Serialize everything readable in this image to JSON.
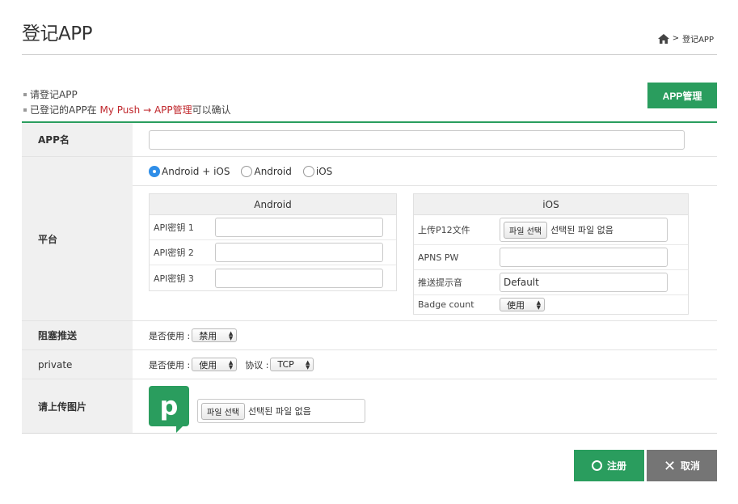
{
  "page": {
    "title": "登记APP"
  },
  "breadcrumb": {
    "separator": ">",
    "current": "登记APP"
  },
  "notes": {
    "line1": "请登记APP",
    "line2_prefix": "已登记的APP在 ",
    "line2_link": "My Push → APP管理",
    "line2_suffix": "可以确认"
  },
  "app_manage_button": "APP管理",
  "form": {
    "app_name": {
      "label": "APP名",
      "value": ""
    },
    "platform": {
      "label": "平台",
      "options": [
        "Android + iOS",
        "Android",
        "iOS"
      ],
      "selected": "Android + iOS",
      "android": {
        "header": "Android",
        "keys": [
          {
            "label": "API密钥 1",
            "value": ""
          },
          {
            "label": "API密钥 2",
            "value": ""
          },
          {
            "label": "API密钥 3",
            "value": ""
          }
        ]
      },
      "ios": {
        "header": "iOS",
        "upload_label": "上传P12文件",
        "file_button": "파일 선택",
        "file_status": "선택된 파일 없음",
        "apns_label": "APNS PW",
        "apns_value": "",
        "sound_label": "推送提示音",
        "sound_value": "Default",
        "badge_label": "Badge count",
        "badge_value": "使用"
      }
    },
    "block_push": {
      "label": "阻塞推送",
      "use_label": "是否使用 :",
      "use_value": "禁用"
    },
    "private": {
      "label": "private",
      "use_label": "是否使用 :",
      "use_value": "使用",
      "protocol_label": "协议 :",
      "protocol_value": "TCP"
    },
    "upload_image": {
      "label": "请上传图片",
      "logo_letter": "p",
      "file_button": "파일 선택",
      "file_status": "선택된 파일 없음"
    }
  },
  "buttons": {
    "register": "注册",
    "cancel": "取消"
  },
  "colors": {
    "accent": "#2a9d5e",
    "link_red": "#c0282d",
    "cancel_gray": "#757575"
  }
}
